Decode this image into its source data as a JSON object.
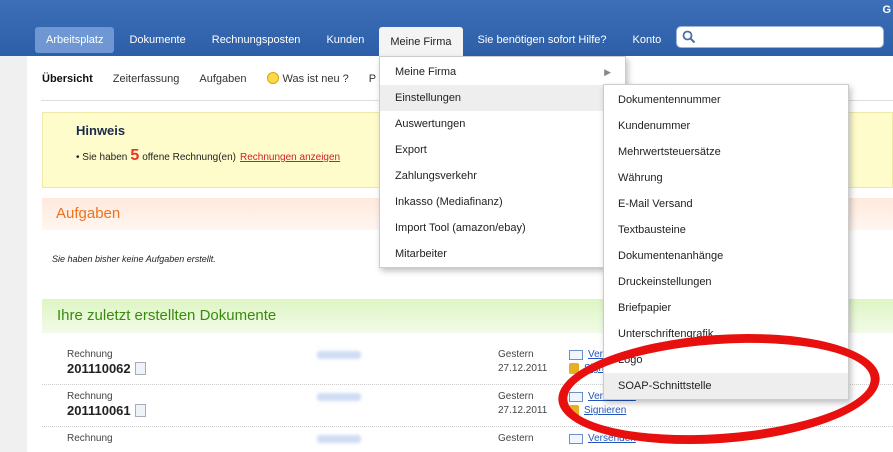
{
  "header": {
    "corner_text": "G",
    "nav": [
      {
        "label": "Arbeitsplatz"
      },
      {
        "label": "Dokumente"
      },
      {
        "label": "Rechnungsposten"
      },
      {
        "label": "Kunden"
      },
      {
        "label": "Meine Firma"
      },
      {
        "label": "Sie benötigen sofort Hilfe?"
      },
      {
        "label": "Konto"
      }
    ],
    "search_placeholder": ""
  },
  "subnav": {
    "items": [
      "Übersicht",
      "Zeiterfassung",
      "Aufgaben",
      "Was ist neu ?",
      "P"
    ]
  },
  "hint": {
    "title": "Hinweis",
    "prefix": "Sie haben",
    "count": "5",
    "suffix": "offene Rechnung(en)",
    "link": "Rechnungen anzeigen"
  },
  "tasks": {
    "title": "Aufgaben",
    "empty": "Sie haben bisher keine Aufgaben erstellt."
  },
  "documents": {
    "title": "Ihre zuletzt erstellten Dokumente",
    "rows": [
      {
        "type": "Rechnung",
        "number": "201110062",
        "date1": "Gestern",
        "date2": "27.12.2011",
        "send": "Versenden",
        "sign": "Signieren"
      },
      {
        "type": "Rechnung",
        "number": "201110061",
        "date1": "Gestern",
        "date2": "27.12.2011",
        "send": "Versenden",
        "sign": "Signieren"
      },
      {
        "type": "Rechnung",
        "number": "",
        "date1": "Gestern",
        "date2": "",
        "send": "Versenden",
        "sign": ""
      }
    ]
  },
  "menu_firma": {
    "items": [
      "Meine Firma",
      "Einstellungen",
      "Auswertungen",
      "Export",
      "Zahlungsverkehr",
      "Inkasso (Mediafinanz)",
      "Import Tool (amazon/ebay)",
      "Mitarbeiter"
    ],
    "submenu_arrow": "▶"
  },
  "menu_settings": {
    "items": [
      "Dokumentennummer",
      "Kundenummer",
      "Mehrwertsteuersätze",
      "Währung",
      "E-Mail Versand",
      "Textbausteine",
      "Dokumentenanhänge",
      "Druckeinstellungen",
      "Briefpapier",
      "Unterschriftengrafik",
      "Logo",
      "SOAP-Schnittstelle"
    ]
  },
  "colors": {
    "topbar": "#3d6fb8",
    "accent_orange": "#f07020",
    "accent_green": "#3a8a10",
    "highlight_oval": "#e8100e"
  }
}
